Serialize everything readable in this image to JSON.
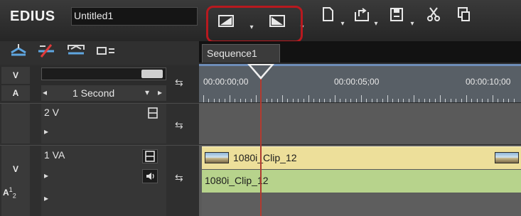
{
  "app": {
    "name": "EDIUS",
    "project_title": "Untitled1"
  },
  "toolbar": {
    "items": [
      "new-sequence-icon",
      "close-sequence-icon",
      "new-project-icon",
      "open-project-icon",
      "save-project-icon",
      "cut-icon",
      "copy-icon"
    ],
    "highlight_color": "#b8191f"
  },
  "sequence_tab": {
    "label": "Sequence1"
  },
  "timeline": {
    "scale_label": "1 Second",
    "timecodes": [
      "00:00:00;00",
      "00:00:05;00",
      "00:00:10;00"
    ]
  },
  "tracks": [
    {
      "label": "2 V"
    },
    {
      "label": "1 VA",
      "audio_label_a": "A",
      "audio_label_n1": "1",
      "audio_label_n2": "2"
    }
  ],
  "clips": {
    "video_name": "1080i_Clip_12",
    "audio_name": "1080i_Clip_12"
  },
  "track_buttons": {
    "v_button": "V",
    "a_button": "A"
  }
}
